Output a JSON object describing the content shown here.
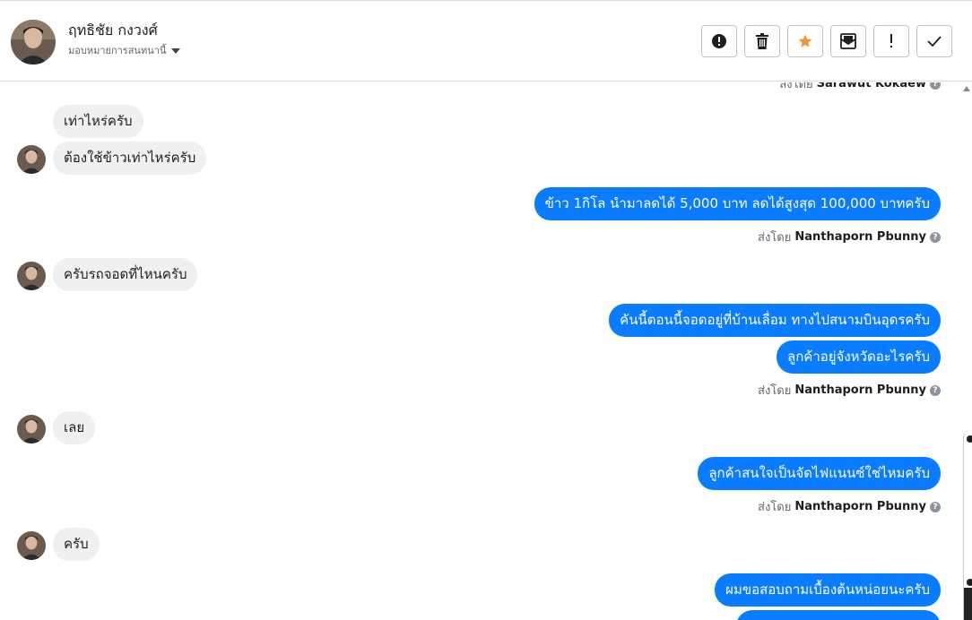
{
  "header": {
    "contact_name": "ฤทธิชัย กงวงศ์",
    "assign_label": "มอบหมายการสนทนานี้"
  },
  "toolbar": {
    "buttons": [
      {
        "icon": "alert-circle-icon",
        "label": "Mark as spam"
      },
      {
        "icon": "trash-icon",
        "label": "Delete"
      },
      {
        "icon": "star-icon",
        "label": "Follow up",
        "color": "#f5923e"
      },
      {
        "icon": "mark-unread-icon",
        "label": "Mark as unread"
      },
      {
        "icon": "exclamation-icon",
        "label": "Important"
      },
      {
        "icon": "check-icon",
        "label": "Done"
      }
    ]
  },
  "colors": {
    "outgoing_bubble": "#0a7cff",
    "incoming_bubble": "#f0f0f0",
    "star": "#f5923e"
  },
  "sent_by_prefix": "ส่งโดย",
  "messages": [
    {
      "type": "sentby",
      "agent": "Sarawut Kokaew"
    },
    {
      "type": "in",
      "text": "เท่าไหร่ครับ"
    },
    {
      "type": "in",
      "text": "ต้องใช้ข้าวเท่าไหร่ครับ"
    },
    {
      "type": "out",
      "text": "ข้าว 1กิโล นำมาลดได้ 5,000 บาท ลดได้สูงสุด 100,000 บาทครับ"
    },
    {
      "type": "sentby",
      "agent": "Nanthaporn Pbunny"
    },
    {
      "type": "in",
      "text": "ครับรถจอดที่ไหนครับ"
    },
    {
      "type": "out",
      "text": "คันนี้ตอนนี้จอดอยู่ที่บ้านเลื่อม ทางไปสนามบินอุดรครับ"
    },
    {
      "type": "out",
      "text": "ลูกค้าอยู่จังหวัดอะไรครับ"
    },
    {
      "type": "sentby",
      "agent": "Nanthaporn Pbunny"
    },
    {
      "type": "in",
      "text": "เลย"
    },
    {
      "type": "out",
      "text": "ลูกค้าสนใจเป็นจัดไฟแนนซ์ใช่ไหมครับ"
    },
    {
      "type": "sentby",
      "agent": "Nanthaporn Pbunny"
    },
    {
      "type": "in",
      "text": "ครับ"
    },
    {
      "type": "out",
      "text": "ผมขอสอบถามเบื้องต้นหน่อยนะครับ"
    }
  ]
}
